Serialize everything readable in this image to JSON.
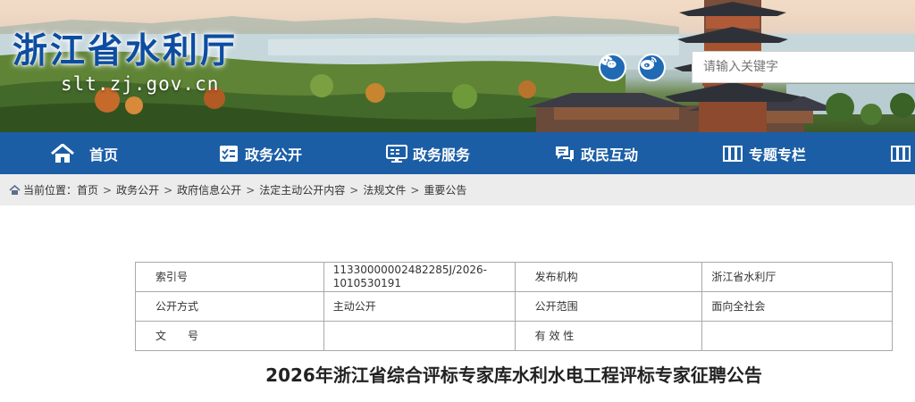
{
  "header": {
    "site_title": "浙江省水利厅",
    "site_domain": "slt.zj.gov.cn",
    "search_placeholder": "请输入关键字"
  },
  "nav": {
    "items": [
      {
        "label": "首页",
        "icon": "home-icon"
      },
      {
        "label": "政务公开",
        "icon": "checklist-icon"
      },
      {
        "label": "政务服务",
        "icon": "monitor-icon"
      },
      {
        "label": "政民互动",
        "icon": "chat-icon"
      },
      {
        "label": "专题专栏",
        "icon": "book-icon"
      }
    ]
  },
  "breadcrumb": {
    "prefix": "当前位置：",
    "items": [
      "首页",
      "政务公开",
      "政府信息公开",
      "法定主动公开内容",
      "法规文件",
      "重要公告"
    ],
    "separator": ">"
  },
  "meta": {
    "index_label": "索引号",
    "index_value": "11330000002482285J/2026-1010530191",
    "publisher_label": "发布机构",
    "publisher_value": "浙江省水利厅",
    "method_label": "公开方式",
    "method_value": "主动公开",
    "scope_label": "公开范围",
    "scope_value": "面向全社会",
    "docno_label": "文　　号",
    "docno_value": "",
    "validity_label": "有 效 性",
    "validity_value": ""
  },
  "article": {
    "title": "2026年浙江省综合评标专家库水利水电工程评标专家征聘公告"
  },
  "colors": {
    "nav_bg": "#1c5ea6",
    "title_blue": "#0d4da1",
    "breadcrumb_bg": "#ececec"
  }
}
